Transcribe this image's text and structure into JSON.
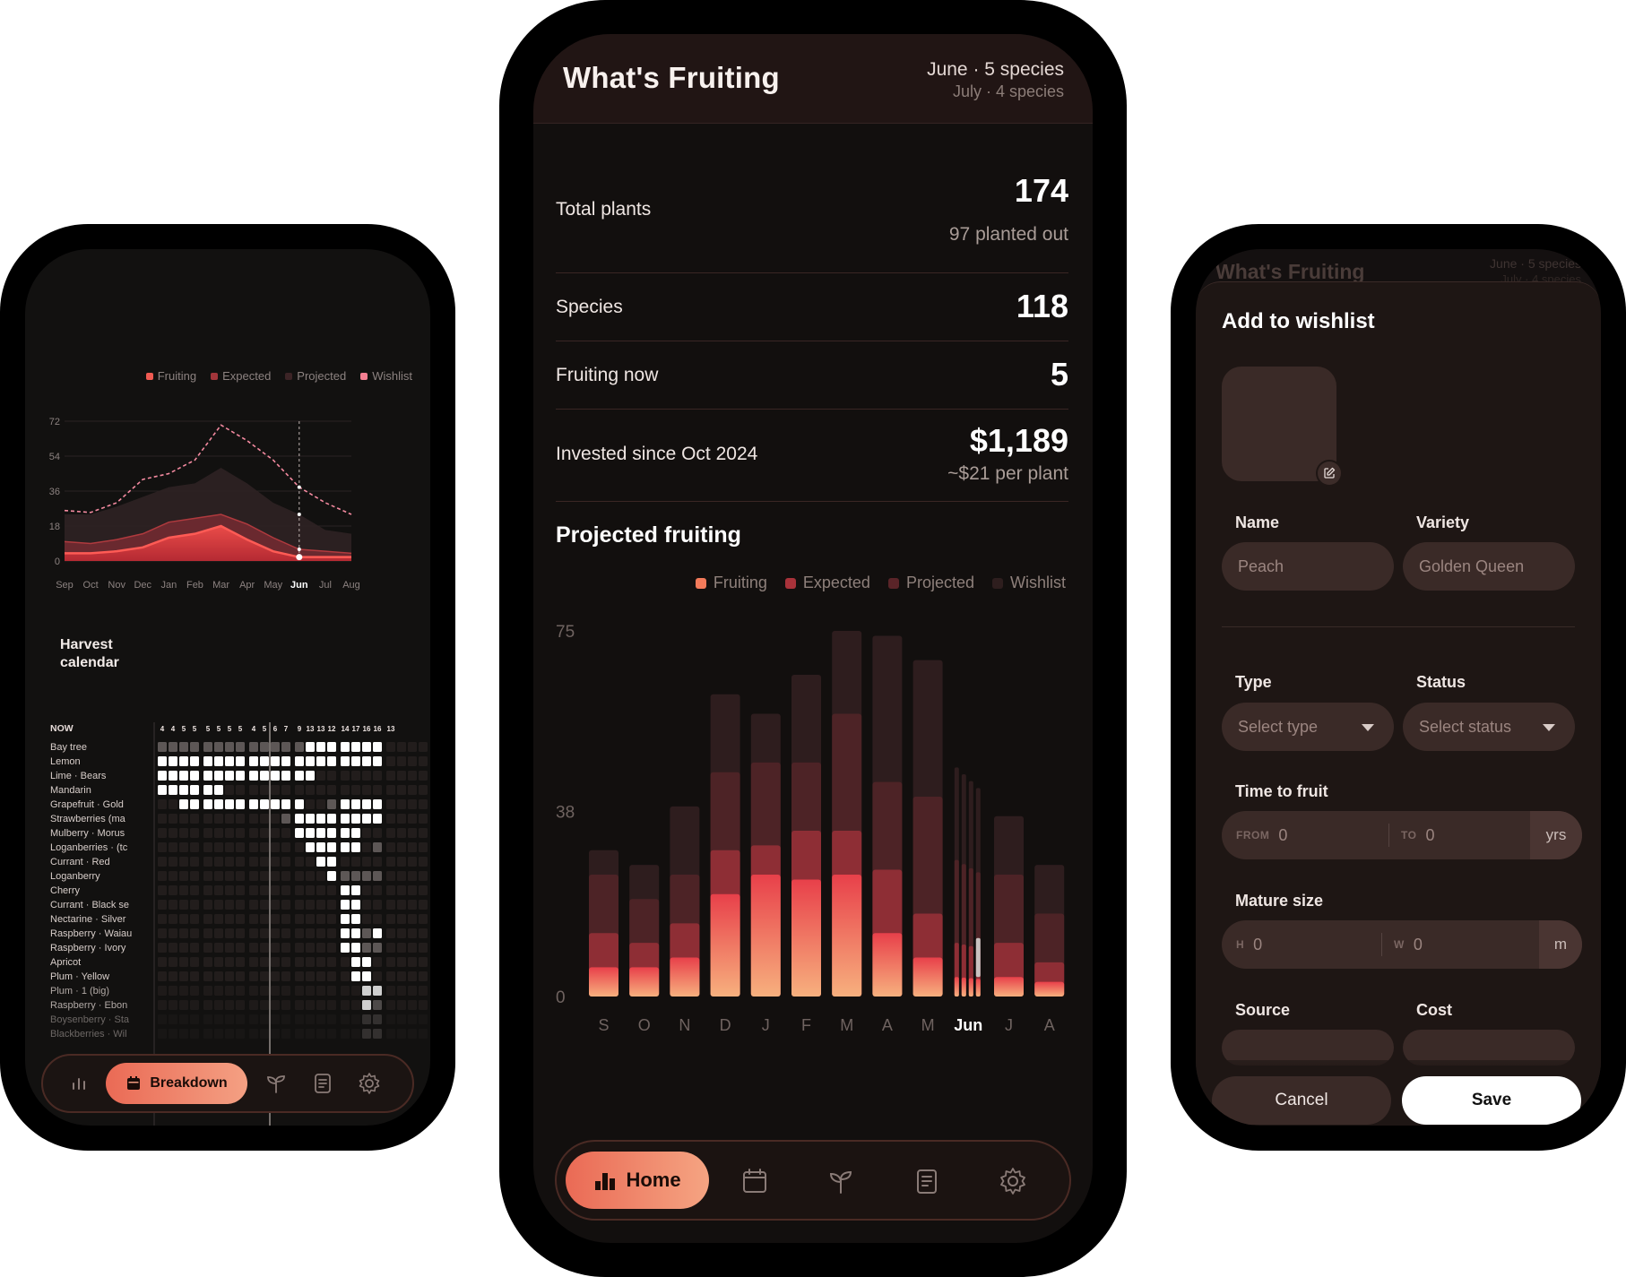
{
  "colors": {
    "fruiting": "#ef6a55",
    "expected": "#a2353a",
    "projected": "#4a2226",
    "wishlist": "#2b1d1d",
    "wishlist_left": "#f47f92",
    "accent": "#f29a7c"
  },
  "left": {
    "legend": [
      "Fruiting",
      "Expected",
      "Projected",
      "Wishlist"
    ],
    "chart_data": {
      "type": "area",
      "x": [
        "Sep",
        "Oct",
        "Nov",
        "Dec",
        "Jan",
        "Feb",
        "Mar",
        "Apr",
        "May",
        "Jun",
        "Jul",
        "Aug"
      ],
      "current": "Jun",
      "yticks": [
        "72",
        "54",
        "36",
        "18",
        "0"
      ],
      "ylim": [
        0,
        72
      ],
      "series": [
        {
          "name": "Fruiting",
          "values": [
            4,
            4,
            5,
            7,
            12,
            14,
            18,
            11,
            5,
            2,
            2,
            2
          ]
        },
        {
          "name": "Expected",
          "values": [
            10,
            9,
            11,
            14,
            20,
            22,
            24,
            19,
            12,
            6,
            5,
            4
          ]
        },
        {
          "name": "Projected",
          "values": [
            24,
            24,
            28,
            33,
            38,
            40,
            48,
            40,
            30,
            24,
            16,
            14
          ]
        },
        {
          "name": "Wishlist",
          "values": [
            26,
            25,
            30,
            42,
            45,
            52,
            70,
            62,
            52,
            38,
            30,
            24
          ]
        }
      ]
    },
    "harvest_title": "Harvest calendar",
    "now_label": "NOW",
    "counts": [
      "4",
      "4",
      "5",
      "5",
      "5",
      "5",
      "5",
      "5",
      "4",
      "5",
      "6",
      "7",
      "9",
      "13",
      "13",
      "12",
      "14",
      "17",
      "16",
      "16",
      "13"
    ],
    "plants": [
      "Bay tree",
      "Lemon",
      "Lime · Bears",
      "Mandarin",
      "Grapefruit · Gold",
      "Strawberries (ma",
      "Mulberry · Morus",
      "Loganberries · (tc",
      "Currant · Red",
      "Loganberry",
      "Cherry",
      "Currant · Black se",
      "Nectarine · Silver",
      "Raspberry · Waiau",
      "Raspberry · Ivory",
      "Apricot",
      "Plum · Yellow",
      "Plum · 1 (big)",
      "Raspberry · Ebon",
      "Boysenberry · Sta",
      "Blackberries · Wil"
    ],
    "nav": {
      "breakdown": "Breakdown"
    }
  },
  "center": {
    "title": "What's Fruiting",
    "month_now": "June · 5 species",
    "month_next": "July · 4 species",
    "stats": [
      {
        "label": "Total plants",
        "value": "174",
        "sub": "97 planted out"
      },
      {
        "label": "Species",
        "value": "118",
        "sub": ""
      },
      {
        "label": "Fruiting now",
        "value": "5",
        "sub": ""
      },
      {
        "label": "Invested since Oct 2024",
        "value": "$1,189",
        "sub": "~$21 per plant"
      }
    ],
    "projected_title": "Projected fruiting",
    "legend": [
      "Fruiting",
      "Expected",
      "Projected",
      "Wishlist"
    ],
    "chart_data": {
      "type": "bar",
      "stacked": true,
      "categories": [
        "S",
        "O",
        "N",
        "D",
        "J",
        "F",
        "M",
        "A",
        "M",
        "Jun",
        "J",
        "A"
      ],
      "current": "Jun",
      "yticks": [
        "75",
        "38",
        "0"
      ],
      "ylim": [
        0,
        75
      ],
      "series": [
        {
          "name": "Fruiting",
          "values": [
            6,
            6,
            8,
            21,
            25,
            24,
            25,
            13,
            8,
            4,
            4,
            3
          ]
        },
        {
          "name": "Expected",
          "values": [
            13,
            11,
            15,
            30,
            31,
            34,
            34,
            26,
            17,
            11,
            11,
            7
          ]
        },
        {
          "name": "Projected",
          "values": [
            25,
            20,
            25,
            46,
            48,
            48,
            58,
            44,
            41,
            28,
            25,
            17
          ]
        },
        {
          "name": "Wishlist",
          "values": [
            30,
            27,
            39,
            62,
            58,
            66,
            75,
            74,
            69,
            47,
            37,
            27
          ]
        }
      ]
    },
    "nav": {
      "home": "Home"
    }
  },
  "right": {
    "bg_title": "What's Fruiting",
    "bg_month_now": "June · 5 species",
    "bg_month_next": "July · 4 species",
    "sheet_title": "Add to wishlist",
    "name_label": "Name",
    "name_placeholder": "Peach",
    "variety_label": "Variety",
    "variety_placeholder": "Golden Queen",
    "type_label": "Type",
    "type_placeholder": "Select type",
    "status_label": "Status",
    "status_placeholder": "Select status",
    "time_label": "Time to fruit",
    "from_tag": "FROM",
    "from_value": "0",
    "to_tag": "TO",
    "to_value": "0",
    "time_unit": "yrs",
    "size_label": "Mature size",
    "h_tag": "H",
    "h_value": "0",
    "w_tag": "W",
    "w_value": "0",
    "size_unit": "m",
    "source_label": "Source",
    "cost_label": "Cost",
    "cancel": "Cancel",
    "save": "Save"
  }
}
